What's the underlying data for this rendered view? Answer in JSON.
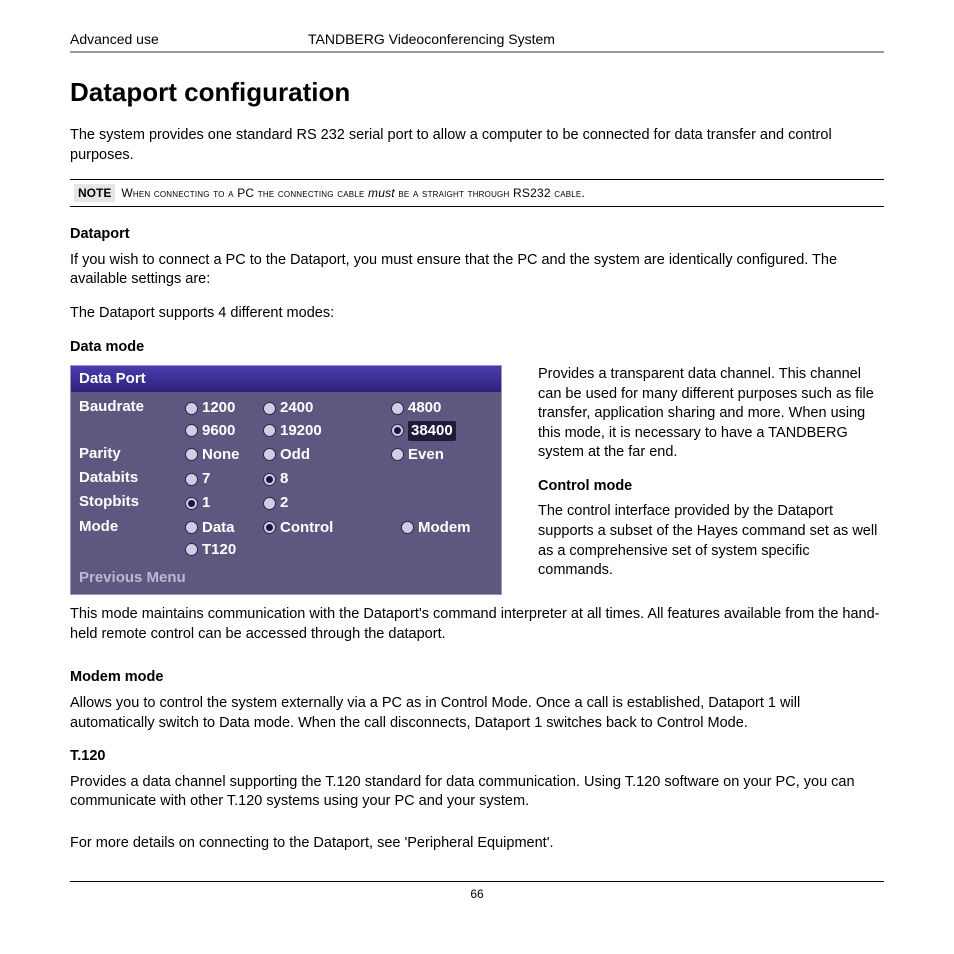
{
  "header": {
    "left": "Advanced use",
    "right": "TANDBERG Videoconferencing System"
  },
  "title": "Dataport configuration",
  "intro": "The system provides one standard RS 232 serial port to allow a computer to be connected for data transfer and control purposes.",
  "note": {
    "label": "NOTE",
    "pre": "When connecting to a ",
    "pc": "PC",
    "mid": " the connecting cable ",
    "must": "must",
    "post": " be a straight through ",
    "rs": "RS232",
    "end": " cable."
  },
  "dataport_h": "Dataport",
  "dataport_p1": "If you wish to connect a PC to the Dataport, you must ensure that the PC and the system are identically configured. The available settings are:",
  "dataport_p2": "The Dataport  supports 4 different modes:",
  "datamode_h": "Data mode",
  "panel": {
    "title": "Data Port",
    "rows": [
      {
        "label": "Baudrate",
        "wrap": true,
        "options": [
          {
            "t": "1200",
            "s": false
          },
          {
            "t": "2400",
            "s": false
          },
          {
            "t": "4800",
            "s": false,
            "far": true
          },
          {
            "t": "9600",
            "s": false
          },
          {
            "t": "19200",
            "s": false
          },
          {
            "t": "38400",
            "s": true,
            "far": true
          }
        ]
      },
      {
        "label": "Parity",
        "options": [
          {
            "t": "None",
            "s": false
          },
          {
            "t": "Odd",
            "s": false
          },
          {
            "t": "Even",
            "s": false,
            "far": true
          }
        ]
      },
      {
        "label": "Databits",
        "options": [
          {
            "t": "7",
            "s": false
          },
          {
            "t": "8",
            "s": true
          }
        ]
      },
      {
        "label": "Stopbits",
        "options": [
          {
            "t": "1",
            "s": true
          },
          {
            "t": "2",
            "s": false
          }
        ]
      },
      {
        "label": "Mode",
        "wrap": true,
        "options": [
          {
            "t": "Data",
            "s": false
          },
          {
            "t": "Control",
            "s": true,
            "wide": true
          },
          {
            "t": "Modem",
            "s": false,
            "far": true
          },
          {
            "t": "T120",
            "s": false
          }
        ]
      }
    ],
    "prev": "Previous Menu"
  },
  "rightcol": {
    "datamode_p": "Provides a transparent data channel. This channel can be used for many different purposes such as file transfer, application sharing and more. When using this mode, it is necessary to have a TANDBERG system at the far end.",
    "control_h": "Control mode",
    "control_p": "The control interface provided by the Dataport supports a subset of the Hayes command set as well as a comprehensive set of system specific commands."
  },
  "after_p": "This mode maintains communication with the Dataport's command interpreter at all times. All features available from the hand-held remote control can be accessed through the dataport.",
  "modem_h": "Modem mode",
  "modem_p": "Allows you to control the system externally via a PC as in Control Mode. Once a call is established, Dataport 1 will automatically switch to Data mode. When the call disconnects, Dataport 1 switches back to Control Mode.",
  "t120_h": "T.120",
  "t120_p": "Provides a data channel supporting the T.120 standard for data communication. Using T.120 software on your PC, you can communicate with other T.120 systems using your PC and your system.",
  "seealso": "For more details on connecting to the Dataport, see 'Peripheral Equipment'.",
  "page": "66"
}
